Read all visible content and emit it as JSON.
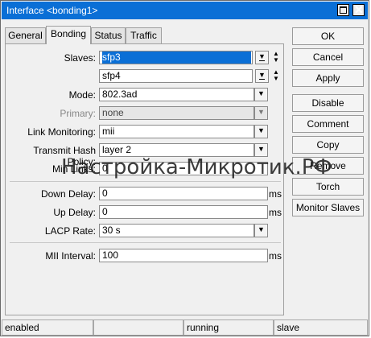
{
  "window": {
    "title": "Interface <bonding1>"
  },
  "tabs": [
    {
      "label": "General"
    },
    {
      "label": "Bonding"
    },
    {
      "label": "Status"
    },
    {
      "label": "Traffic"
    }
  ],
  "form": {
    "slaves_label": "Slaves:",
    "slaves": [
      "sfp3",
      "sfp4"
    ],
    "mode_label": "Mode:",
    "mode_value": "802.3ad",
    "primary_label": "Primary:",
    "primary_value": "none",
    "link_monitoring_label": "Link Monitoring:",
    "link_monitoring_value": "mii",
    "hash_policy_label": "Transmit Hash Policy:",
    "hash_policy_value": "layer 2",
    "min_links_label": "Min Links:",
    "min_links_value": "0",
    "down_delay_label": "Down Delay:",
    "down_delay_value": "0",
    "down_delay_unit": "ms",
    "up_delay_label": "Up Delay:",
    "up_delay_value": "0",
    "up_delay_unit": "ms",
    "lacp_rate_label": "LACP Rate:",
    "lacp_rate_value": "30 s",
    "mii_interval_label": "MII Interval:",
    "mii_interval_value": "100",
    "mii_interval_unit": "ms"
  },
  "buttons": {
    "ok": "OK",
    "cancel": "Cancel",
    "apply": "Apply",
    "disable": "Disable",
    "comment": "Comment",
    "copy": "Copy",
    "remove": "Remove",
    "torch": "Torch",
    "monitor_slaves": "Monitor Slaves"
  },
  "status": {
    "enabled": "enabled",
    "empty": "",
    "running": "running",
    "slave": "slave"
  },
  "watermark": "Настройка-Микротик.РФ",
  "colors": {
    "titlebar": "#0a6fd6",
    "selection": "#0a6fd6",
    "background": "#f0f0f0"
  }
}
